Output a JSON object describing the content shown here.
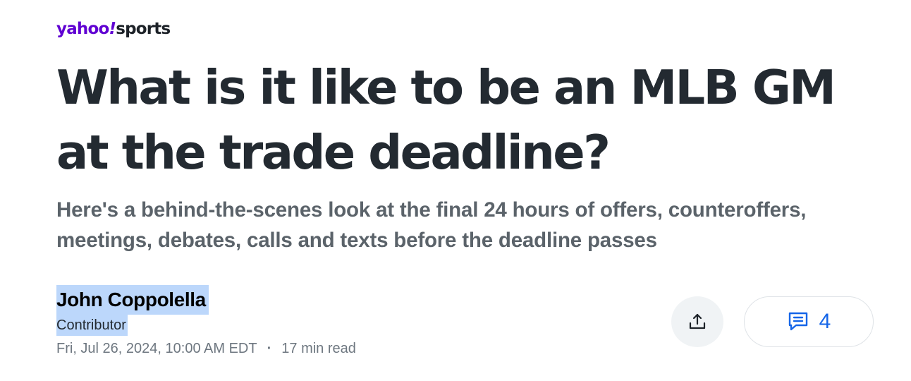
{
  "header": {
    "brand": "yahoo",
    "brand_mark": "!",
    "section": "sports"
  },
  "article": {
    "headline": "What is it like to be an MLB GM at the trade deadline?",
    "subheadline": "Here's a behind-the-scenes look at the final 24 hours of offers, counteroffers, meetings, debates, calls and texts before the deadline passes",
    "author": {
      "name": "John Coppolella",
      "role": "Contributor"
    },
    "published": "Fri, Jul 26, 2024, 10:00 AM EDT",
    "separator": "·",
    "read_time": "17 min read"
  },
  "actions": {
    "share_icon": "share-icon",
    "comments_icon": "comment-icon",
    "comments_count": "4"
  },
  "colors": {
    "brand_purple": "#6001d2",
    "headline": "#232a31",
    "subheadline": "#5b636a",
    "selection_highlight": "#bcd7fb",
    "accent_blue": "#1565e8"
  }
}
